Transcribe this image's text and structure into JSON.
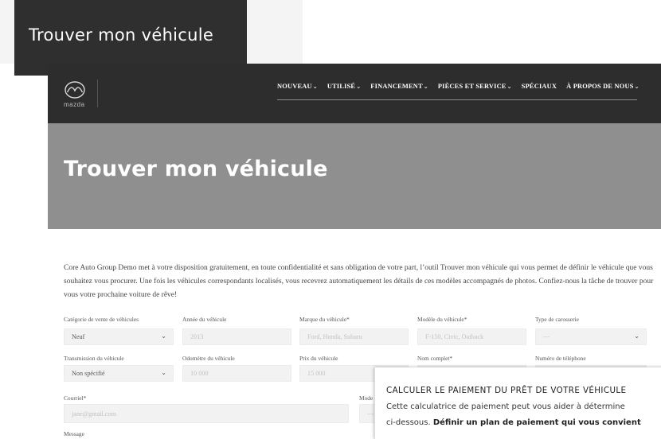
{
  "page_tag": "Trouver mon véhicule",
  "logo_label": "mazda",
  "nav": [
    {
      "label": "NOUVEAU",
      "chevron": true
    },
    {
      "label": "UTILISÉ",
      "chevron": true
    },
    {
      "label": "FINANCEMENT",
      "chevron": true
    },
    {
      "label": "PIÈCES ET SERVICE",
      "chevron": true
    },
    {
      "label": "SPÉCIAUX",
      "chevron": false
    },
    {
      "label": "À PROPOS DE NOUS",
      "chevron": true
    }
  ],
  "hero_title": "Trouver mon véhicule",
  "intro": "Core Auto Group Demo met à votre disposition gratuitement, en toute confidentialité et sans obligation de votre part, l’outil Trouver mon véhicule qui vous permet de définir le véhicule que vous souhaitez vous procurer. Une fois les véhicules correspondants localisés, vous recevrez automatiquement les détails de ces modèles accompagnés de photos. Confiez-nous la tâche de trouver pour vous votre prochaine voiture de rêve!",
  "form": {
    "sale_category": {
      "label": "Catégorie de vente de véhicules",
      "value": "Neuf"
    },
    "year": {
      "label": "Année du véhicule",
      "placeholder": "2013"
    },
    "make": {
      "label": "Marque du véhicule*",
      "placeholder": "Ford, Honda, Subaru"
    },
    "model": {
      "label": "Modèle du véhicule*",
      "placeholder": "F-150, Civic, Outback"
    },
    "body_type": {
      "label": "Type de carosserie",
      "value": "---"
    },
    "transmission": {
      "label": "Transmission du véhicule",
      "value": "Non spécifié"
    },
    "odometer": {
      "label": "Odomètre du véhicule",
      "placeholder": "10 000"
    },
    "price": {
      "label": "Prix du véhicule",
      "placeholder": "15 000"
    },
    "full_name": {
      "label": "Nom complet*"
    },
    "phone": {
      "label": "Numéro de téléphone"
    },
    "email": {
      "label": "Courriel*",
      "placeholder": "jane@gmail.com"
    },
    "mode": {
      "label": "Mode",
      "value": "---"
    },
    "message": {
      "label": "Message"
    }
  },
  "popup": {
    "title": "CALCULER LE PAIEMENT DU PRÊT DE VOTRE VÉHICULE",
    "line1": "Cette calculatrice de paiement peut vous aider à détermine",
    "line2_prefix": "ci-dessous. ",
    "line2_bold": "Définir un plan de paiement qui vous convient"
  },
  "colors": {
    "dark": "#2d2d2d",
    "hero": "#8f8f8f",
    "field_bg": "#f2f2f2"
  }
}
